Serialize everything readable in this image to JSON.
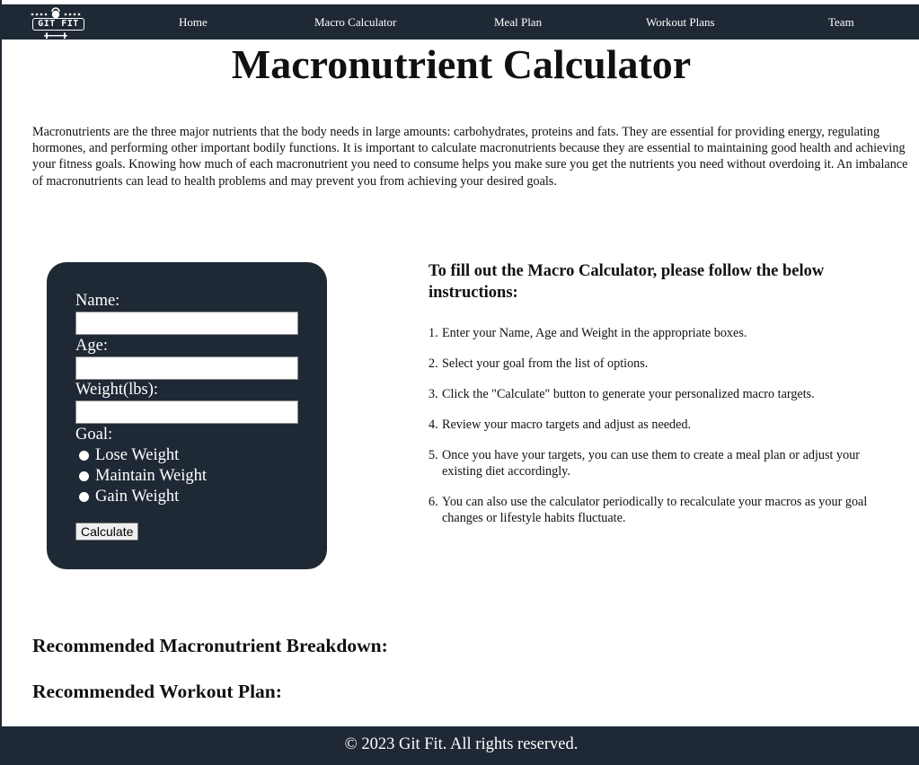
{
  "nav": {
    "logo_text": "GIT FIT",
    "links": [
      "Home",
      "Macro Calculator",
      "Meal Plan",
      "Workout Plans",
      "Team"
    ]
  },
  "page": {
    "title": "Macronutrient Calculator",
    "intro": "Macronutrients are the three major nutrients that the body needs in large amounts: carbohydrates, proteins and fats. They are essential for providing energy, regulating hormones, and performing other important bodily functions. It is important to calculate macronutrients because they are essential to maintaining good health and achieving your fitness goals. Knowing how much of each macronutrient you need to consume helps you make sure you get the nutrients you need without overdoing it. An imbalance of macronutrients can lead to health problems and may prevent you from achieving your desired goals."
  },
  "form": {
    "name_label": "Name:",
    "name_value": "",
    "age_label": "Age:",
    "age_value": "",
    "weight_label": "Weight(lbs):",
    "weight_value": "",
    "goal_label": "Goal:",
    "goal_options": [
      "Lose Weight",
      "Maintain Weight",
      "Gain Weight"
    ],
    "submit_label": "Calculate"
  },
  "instructions": {
    "heading": "To fill out the Macro Calculator, please follow the below instructions:",
    "steps": [
      "Enter your Name, Age and Weight in the appropriate boxes.",
      "Select your goal from the list of options.",
      "Click the \"Calculate\" button to generate your personalized macro targets.",
      "Review your macro targets and adjust as needed.",
      "Once you have your targets, you can use them to create a meal plan or adjust your existing diet accordingly.",
      "You can also use the calculator periodically to recalculate your macros as your goal changes or lifestyle habits fluctuate."
    ]
  },
  "results": {
    "macro_heading": "Recommended Macronutrient Breakdown:",
    "workout_heading": "Recommended Workout Plan:"
  },
  "footer": {
    "text": "© 2023 Git Fit. All rights reserved."
  },
  "colors": {
    "navy": "#1f2935",
    "white": "#ffffff"
  }
}
